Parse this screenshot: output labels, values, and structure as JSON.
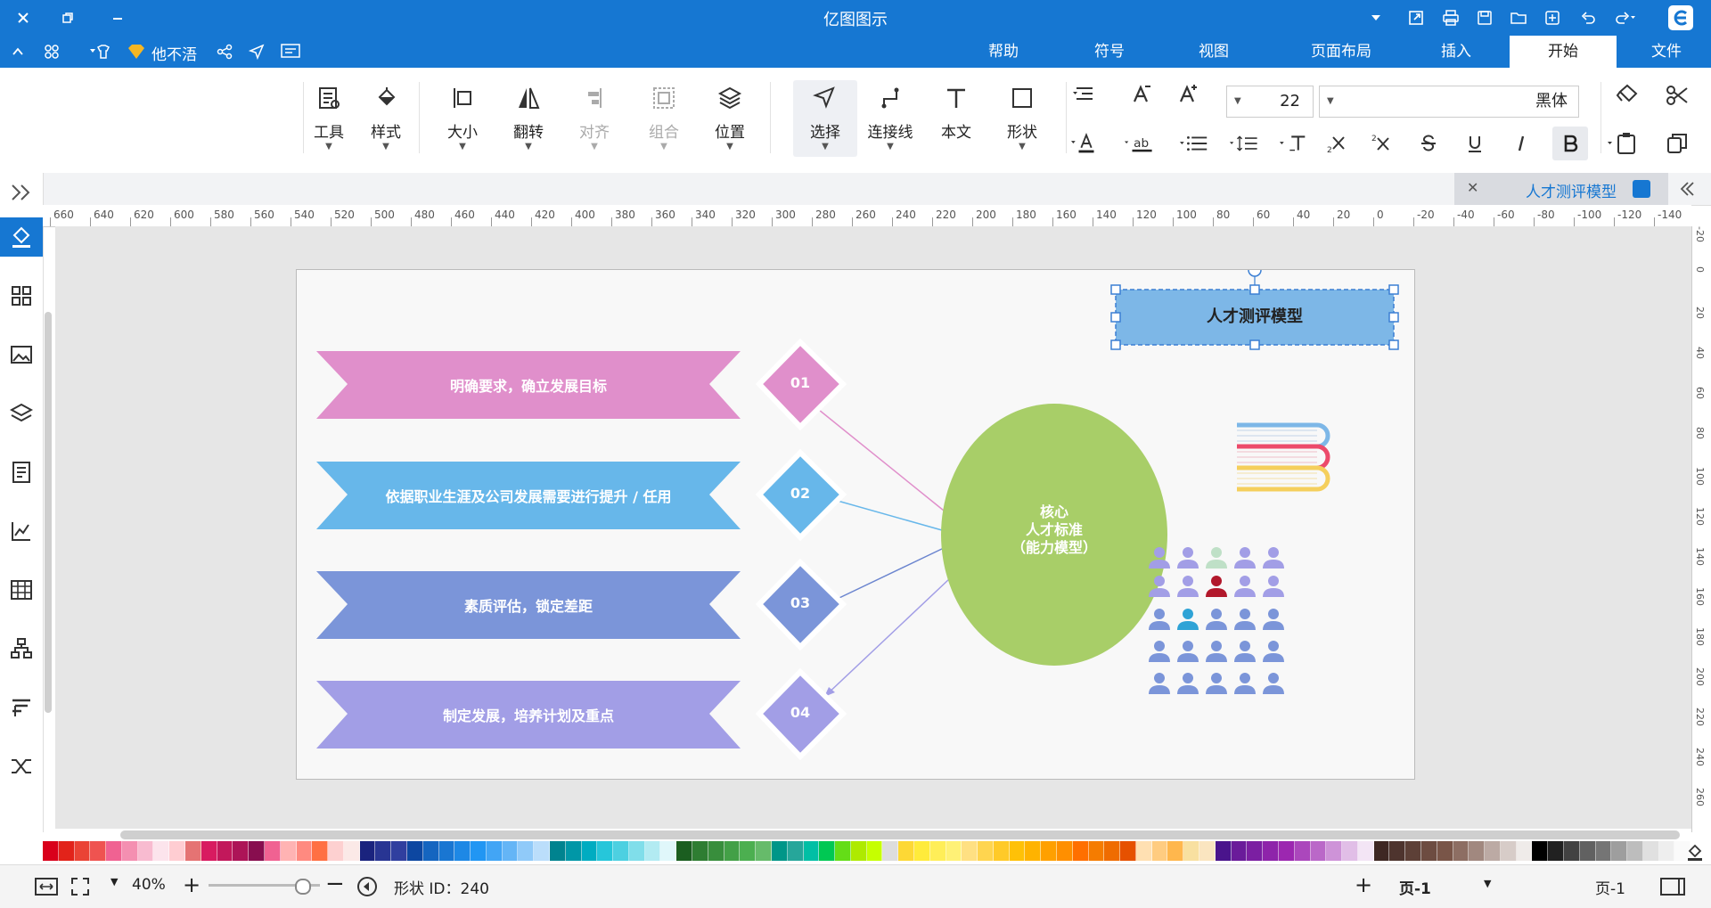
{
  "app": {
    "title": "亿图图示"
  },
  "menu_tabs": [
    {
      "label": "文件",
      "active": false
    },
    {
      "label": "开始",
      "active": true
    },
    {
      "label": "插入",
      "active": false
    },
    {
      "label": "页面布局",
      "active": false
    },
    {
      "label": "视图",
      "active": false
    },
    {
      "label": "符号",
      "active": false
    },
    {
      "label": "帮助",
      "active": false
    }
  ],
  "user": {
    "name": "他不浯"
  },
  "ribbon": {
    "font_name": "黑体",
    "font_size": "22",
    "buttons": {
      "shape": "形状",
      "text": "本文",
      "connector": "连接线",
      "select": "选择",
      "position": "位置",
      "group": "组合",
      "align": "对齐",
      "flip": "翻转",
      "size": "大小",
      "style": "样式",
      "tools": "工具"
    }
  },
  "document": {
    "tab_title": "人才测评模型"
  },
  "diagram": {
    "title_box": "人才测评模型",
    "core": [
      "核心",
      "人才标准",
      "（能力模型）"
    ],
    "items": [
      {
        "num": "01",
        "text": "明确要求，确立发展目标",
        "color": "#e08fcb",
        "arrow": "#e08fcb"
      },
      {
        "num": "02",
        "text": "依据职业生涯及公司发展需要进行提升 / 任用",
        "color": "#67b7ea",
        "arrow": "#67b7ea"
      },
      {
        "num": "03",
        "text": "素质评估，锁定差距",
        "color": "#7b95d9",
        "arrow": "#6b85cf"
      },
      {
        "num": "04",
        "text": "制定发展，培养计划及重点",
        "color": "#a29ee6",
        "arrow": "#a29ee6"
      }
    ],
    "core_color": "#a8ce68",
    "title_fill": "#7db7e7"
  },
  "ruler": {
    "h_labels": [
      "-140",
      "-120",
      "-100",
      "-80",
      "-60",
      "-40",
      "-20",
      "0",
      "20",
      "40",
      "60",
      "80",
      "100",
      "120",
      "140",
      "160",
      "180",
      "200",
      "220",
      "240",
      "260",
      "280",
      "300",
      "320",
      "340",
      "360",
      "380",
      "400",
      "420",
      "440",
      "460",
      "480",
      "500",
      "520",
      "540",
      "560",
      "580",
      "600",
      "620",
      "640",
      "660"
    ],
    "v_labels": [
      "-20",
      "0",
      "20",
      "40",
      "60",
      "80",
      "100",
      "120",
      "140",
      "160",
      "180",
      "200",
      "220",
      "240",
      "260"
    ]
  },
  "status": {
    "page_selector": "页-1",
    "current_page": "页-1",
    "shape_id": "形状 ID：240",
    "zoom": "40%"
  },
  "palette": [
    "#d9001b",
    "#e2231a",
    "#ea4335",
    "#ef5350",
    "#f06292",
    "#f48fb1",
    "#f8bbd0",
    "#fce4ec",
    "#ffcdd2",
    "#e57373",
    "#d81b60",
    "#c2185b",
    "#ad1457",
    "#880e4f",
    "#f06292",
    "#ffb3b3",
    "#ff8a80",
    "#ff7043",
    "#fdd0d0",
    "#fbe9e7",
    "#1a237e",
    "#283593",
    "#303f9f",
    "#0d47a1",
    "#1565c0",
    "#1976d2",
    "#1e88e5",
    "#2196f3",
    "#42a5f5",
    "#64b5f6",
    "#90caf9",
    "#bbdefb",
    "#00838f",
    "#0097a7",
    "#00acc1",
    "#26c6da",
    "#4dd0e1",
    "#80deea",
    "#b2ebf2",
    "#e0f7fa",
    "#1b5e20",
    "#2e7d32",
    "#388e3c",
    "#43a047",
    "#4caf50",
    "#66bb6a",
    "#009688",
    "#26a69a",
    "#00bfa5",
    "#00c853",
    "#64dd17",
    "#aeea00",
    "#c6ff00",
    "#ddd",
    "#fdd835",
    "#ffeb3b",
    "#ffee58",
    "#fff176",
    "#ffe082",
    "#ffd54f",
    "#ffca28",
    "#ffc107",
    "#ffb300",
    "#ffa000",
    "#ff8f00",
    "#ff6f00",
    "#f57c00",
    "#ef6c00",
    "#e65100",
    "#ffe0b2",
    "#ffcc80",
    "#ffb74d",
    "#f8e0a0",
    "#fae5c0",
    "#4a148c",
    "#6a1b9a",
    "#7b1fa2",
    "#8e24aa",
    "#9c27b0",
    "#ab47bc",
    "#ba68c8",
    "#ce93d8",
    "#e1bee7",
    "#f3e5f5",
    "#3e2723",
    "#4e342e",
    "#5d4037",
    "#6d4c41",
    "#795548",
    "#8d6e63",
    "#a1887f",
    "#bcaaa4",
    "#d7ccc8",
    "#efebe9",
    "#000000",
    "#212121",
    "#424242",
    "#616161",
    "#757575",
    "#9e9e9e",
    "#bdbdbd",
    "#e0e0e0",
    "#eeeeee",
    "#fafafa"
  ]
}
